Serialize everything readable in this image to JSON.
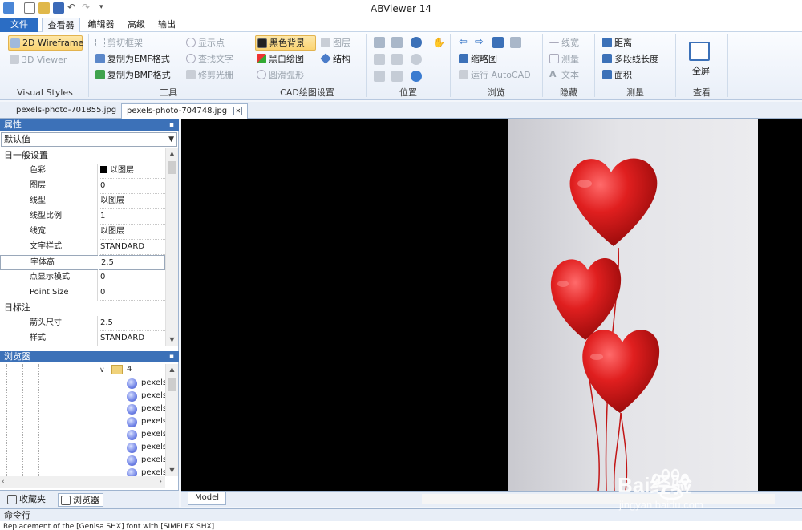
{
  "app": {
    "title": "ABViewer 14"
  },
  "menu": {
    "tabs": [
      {
        "label": "文件"
      },
      {
        "label": "查看器"
      },
      {
        "label": "编辑器"
      },
      {
        "label": "高级"
      },
      {
        "label": "输出"
      }
    ]
  },
  "ribbon": {
    "visual_styles": {
      "label": "Visual Styles",
      "wireframe_2d": "2D Wireframe",
      "viewer_3d": "3D Viewer"
    },
    "tools": {
      "label": "工具",
      "clip_frame": "剪切框架",
      "copy_emf": "复制为EMF格式",
      "copy_bmp": "复制为BMP格式",
      "show_points": "显示点",
      "find_text": "查找文字",
      "trim_raster": "修剪光栅"
    },
    "cad_settings": {
      "label": "CAD绘图设置",
      "black_bg": "黑色背景",
      "layers": "图层",
      "bw_drawing": "黑白绘图",
      "structure": "结构",
      "smooth_arc": "圆滑弧形"
    },
    "position": {
      "label": "位置"
    },
    "browse": {
      "label": "浏览",
      "thumbnails": "缩略图",
      "run_autocad": "运行 AutoCAD"
    },
    "hide": {
      "label": "隐藏",
      "line_width": "线宽",
      "measure": "测量",
      "text": "文本"
    },
    "measure": {
      "label": "测量",
      "distance": "距离",
      "polyline_length": "多段线长度",
      "area": "面积"
    },
    "view": {
      "label": "查看",
      "fullscreen": "全屏"
    }
  },
  "doc_tabs": [
    {
      "label": "pexels-photo-701855.jpg"
    },
    {
      "label": "pexels-photo-704748.jpg"
    }
  ],
  "properties": {
    "title": "属性",
    "dropdown_value": "默认值",
    "rows": [
      {
        "name": "日一般设置",
        "value": ""
      },
      {
        "name": "色彩",
        "value": "以图层"
      },
      {
        "name": "图层",
        "value": "0"
      },
      {
        "name": "线型",
        "value": "以图层"
      },
      {
        "name": "线型比例",
        "value": "1"
      },
      {
        "name": "线宽",
        "value": "以图层"
      },
      {
        "name": "文字样式",
        "value": "STANDARD"
      },
      {
        "name": "字体高",
        "value": "2.5"
      },
      {
        "name": "点显示模式",
        "value": "0"
      },
      {
        "name": "Point Size",
        "value": "0"
      },
      {
        "name": "日标注",
        "value": ""
      },
      {
        "name": "箭头尺寸",
        "value": "2.5"
      },
      {
        "name": "样式",
        "value": "STANDARD"
      }
    ]
  },
  "browser": {
    "title": "浏览器",
    "folder": "4",
    "items": [
      "pexels",
      "pexels",
      "pexels",
      "pexels",
      "pexels",
      "pexels",
      "pexels",
      "pexels"
    ]
  },
  "bottom_tabs": {
    "favorites": "收藏夹",
    "browser": "浏览器"
  },
  "canvas": {
    "model_tab": "Model"
  },
  "command": {
    "title": "命令行",
    "text": "Replacement of the [Genisa SHX] font with [SIMPLEX SHX]"
  },
  "watermark": {
    "brand": "Bai经验",
    "url": "jingyan.baidu.com"
  },
  "colors": {
    "accent": "#2b6dc4",
    "panel_header": "#3c71b8",
    "selected_button": "#fbd472",
    "balloon": "#d81f1f"
  }
}
